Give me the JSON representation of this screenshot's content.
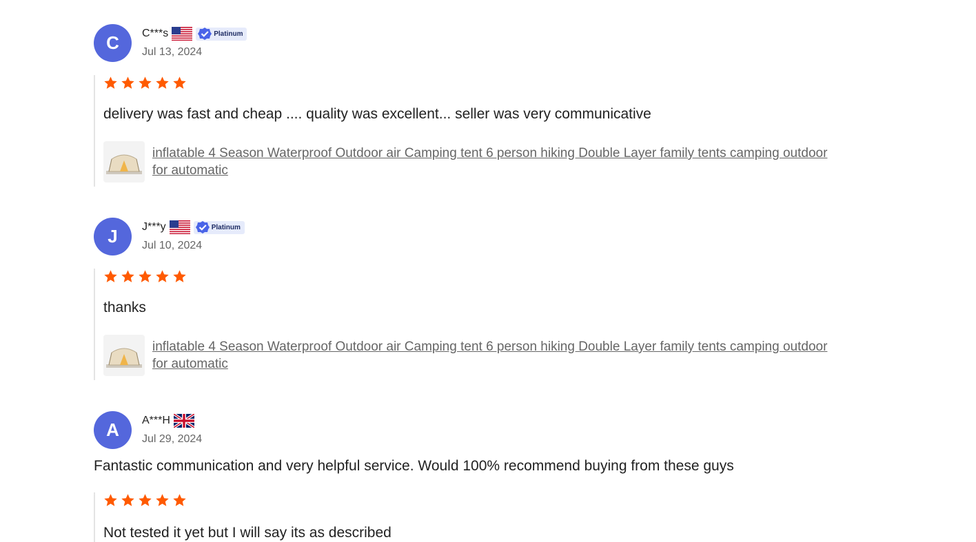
{
  "reviews": [
    {
      "initial": "C",
      "username": "C***s",
      "flag": "us-flag-icon",
      "badge": "Platinum",
      "date": "Jul 13, 2024",
      "rating": 5,
      "text": "delivery was fast and cheap .... quality was excellent... seller was very communicative",
      "product": "inflatable 4 Season Waterproof Outdoor air Camping tent 6 person hiking Double Layer family tents camping outdoor for automatic"
    },
    {
      "initial": "J",
      "username": "J***y",
      "flag": "us-flag-icon",
      "badge": "Platinum",
      "date": "Jul 10, 2024",
      "rating": 5,
      "text": "thanks",
      "product": "inflatable 4 Season Waterproof Outdoor air Camping tent 6 person hiking Double Layer family tents camping outdoor for automatic"
    },
    {
      "initial": "A",
      "username": "A***H",
      "flag": "uk-flag-icon",
      "date": "Jul 29, 2024",
      "supplier_comment": "Fantastic communication and very helpful service. Would 100% recommend buying from these guys",
      "rating": 5,
      "text": "Not tested it yet but I will say its as described"
    }
  ],
  "colors": {
    "avatar": "#5467dc",
    "star": "#ff5a00",
    "badge_bg": "#e6ebfb",
    "badge_check": "#4a64e8"
  }
}
